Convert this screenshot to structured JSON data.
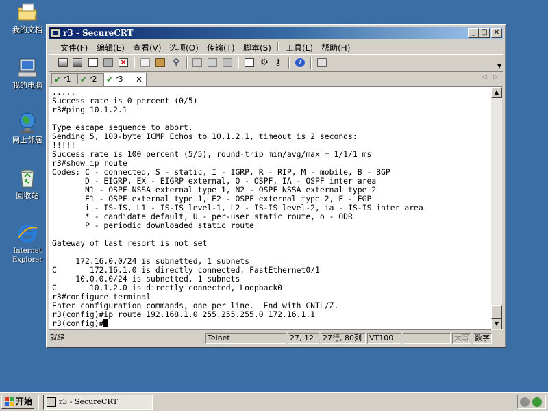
{
  "desktop": {
    "icons": [
      {
        "label": "我的文档"
      },
      {
        "label": "我的电脑"
      },
      {
        "label": "网上邻居"
      },
      {
        "label": "回收站"
      },
      {
        "label": "Internet Explorer"
      }
    ]
  },
  "window": {
    "title": "r3 - SecureCRT",
    "menu": [
      "文件(F)",
      "编辑(E)",
      "查看(V)",
      "选项(O)",
      "传输(T)",
      "脚本(S)",
      "工具(L)",
      "帮助(H)"
    ],
    "tabs": [
      {
        "label": "r1",
        "active": false
      },
      {
        "label": "r2",
        "active": false
      },
      {
        "label": "r3",
        "active": true
      }
    ],
    "terminal_lines": [
      ".....",
      "Success rate is 0 percent (0/5)",
      "r3#ping 10.1.2.1",
      "",
      "Type escape sequence to abort.",
      "Sending 5, 100-byte ICMP Echos to 10.1.2.1, timeout is 2 seconds:",
      "!!!!!",
      "Success rate is 100 percent (5/5), round-trip min/avg/max = 1/1/1 ms",
      "r3#show ip route",
      "Codes: C - connected, S - static, I - IGRP, R - RIP, M - mobile, B - BGP",
      "       D - EIGRP, EX - EIGRP external, O - OSPF, IA - OSPF inter area",
      "       N1 - OSPF NSSA external type 1, N2 - OSPF NSSA external type 2",
      "       E1 - OSPF external type 1, E2 - OSPF external type 2, E - EGP",
      "       i - IS-IS, L1 - IS-IS level-1, L2 - IS-IS level-2, ia - IS-IS inter area",
      "       * - candidate default, U - per-user static route, o - ODR",
      "       P - periodic downloaded static route",
      "",
      "Gateway of last resort is not set",
      "",
      "     172.16.0.0/24 is subnetted, 1 subnets",
      "C       172.16.1.0 is directly connected, FastEthernet0/1",
      "     10.0.0.0/24 is subnetted, 1 subnets",
      "C       10.1.2.0 is directly connected, Loopback0",
      "r3#configure terminal",
      "Enter configuration commands, one per line.  End with CNTL/Z.",
      "r3(config)#ip route 192.168.1.0 255.255.255.0 172.16.1.1",
      "r3(config)#"
    ],
    "status": {
      "ready": "就绪",
      "protocol": "Telnet",
      "cursor_pos": "27, 12",
      "size": "27行, 80列",
      "emulation": "VT100",
      "caps": "大写",
      "num": "数字"
    }
  },
  "taskbar": {
    "start_label": "开始",
    "task_label": "r3 - SecureCRT"
  },
  "colors": {
    "desktop": "#3a6ea5",
    "title_active": "#0a246a",
    "face": "#d4d0c8"
  }
}
